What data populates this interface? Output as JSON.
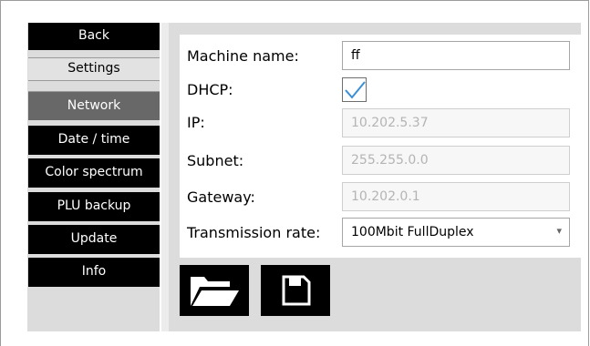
{
  "sidebar": {
    "back_label": "Back",
    "section_label": "Settings",
    "items": [
      {
        "label": "Network",
        "active": true
      },
      {
        "label": "Date / time",
        "active": false
      },
      {
        "label": "Color spectrum",
        "active": false
      },
      {
        "label": "PLU backup",
        "active": false
      },
      {
        "label": "Update",
        "active": false
      },
      {
        "label": "Info",
        "active": false
      }
    ]
  },
  "form": {
    "machine_name": {
      "label": "Machine name:",
      "value": "ff"
    },
    "dhcp": {
      "label": "DHCP:",
      "checked": true
    },
    "ip": {
      "label": "IP:",
      "value": "10.202.5.37",
      "disabled": true
    },
    "subnet": {
      "label": "Subnet:",
      "value": "255.255.0.0",
      "disabled": true
    },
    "gateway": {
      "label": "Gateway:",
      "value": "10.202.0.1",
      "disabled": true
    },
    "transmission_rate": {
      "label": "Transmission rate:",
      "value": "100Mbit FullDuplex"
    }
  },
  "toolbar": {
    "open_icon": "folder-open-icon",
    "save_icon": "floppy-disk-icon"
  },
  "colors": {
    "nav_bg": "#000000",
    "nav_active_bg": "#686868",
    "panel_bg": "#dcdcdc",
    "checkmark": "#3a8fd6"
  }
}
